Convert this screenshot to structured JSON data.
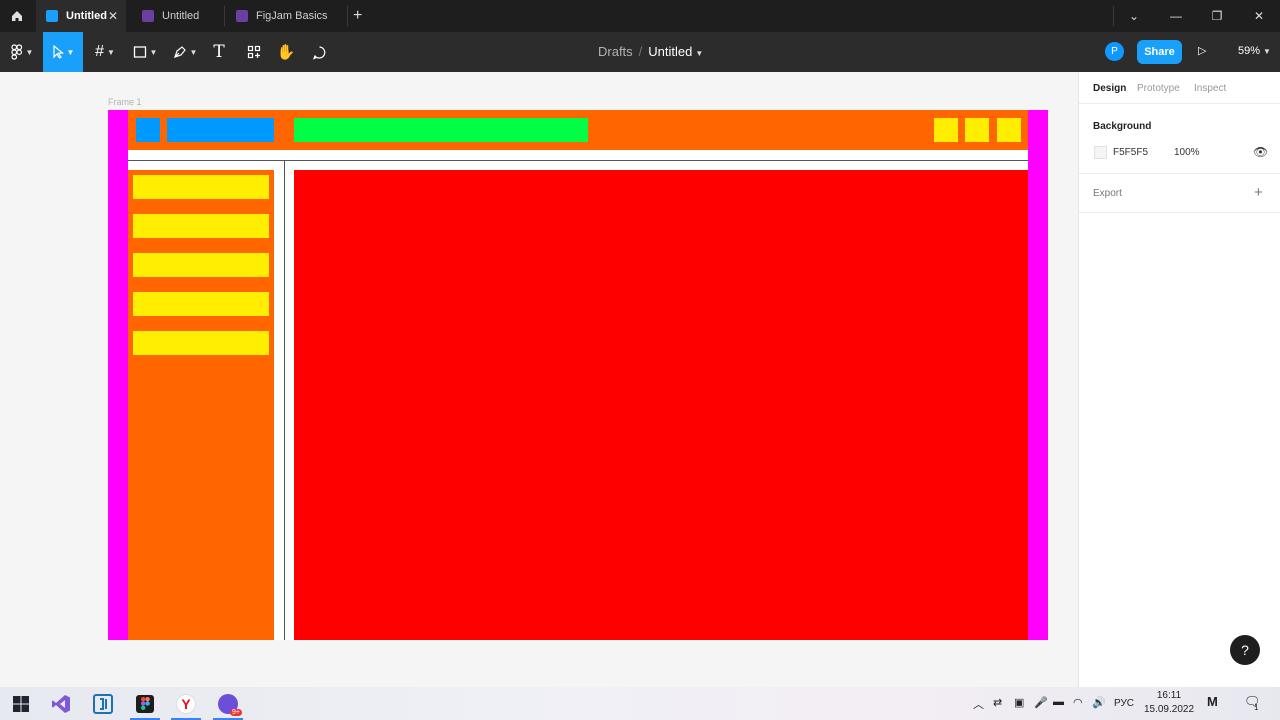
{
  "tabs": [
    {
      "label": "Untitled",
      "active": true,
      "icon_color": "#18a0fb"
    },
    {
      "label": "Untitled",
      "active": false,
      "icon_color": "#6b3fa0"
    },
    {
      "label": "FigJam Basics",
      "active": false,
      "icon_color": "#6b3fa0"
    }
  ],
  "toolbar": {
    "breadcrumb_root": "Drafts",
    "breadcrumb_sep": "/",
    "file_name": "Untitled",
    "avatar_initial": "P",
    "share_label": "Share",
    "zoom": "59%"
  },
  "canvas": {
    "frame_label": "Frame 1",
    "colors": {
      "magenta": "#ff00ff",
      "orange": "#ff6600",
      "blue": "#0099ff",
      "green": "#00ff44",
      "yellow": "#ffee00",
      "red": "#ff0000"
    }
  },
  "panel": {
    "tabs": [
      "Design",
      "Prototype",
      "Inspect"
    ],
    "background_heading": "Background",
    "background_hex": "F5F5F5",
    "background_opacity": "100%",
    "export_heading": "Export",
    "help": "?"
  },
  "taskbar": {
    "lang": "РУС",
    "time": "16:11",
    "date": "15.09.2022",
    "notif_count": "1"
  }
}
